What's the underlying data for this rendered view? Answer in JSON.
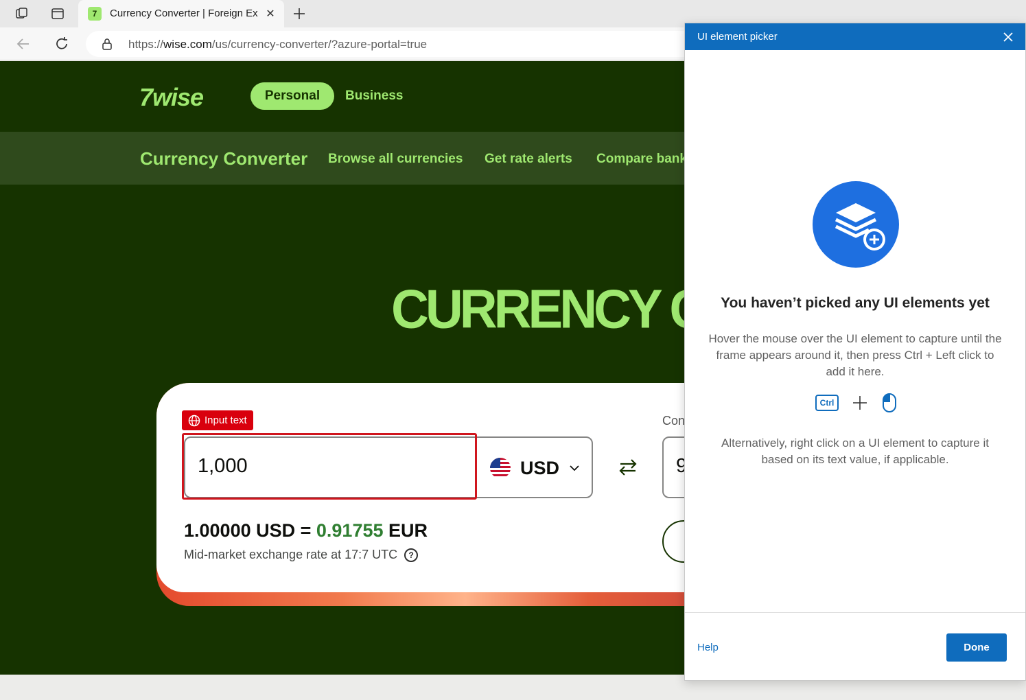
{
  "browser": {
    "tab_title": "Currency Converter | Foreign Exc",
    "url_prefix": "https://",
    "url_host": "wise.com",
    "url_path": "/us/currency-converter/?azure-portal=true"
  },
  "site": {
    "logo": "7wise",
    "nav_personal": "Personal",
    "nav_business": "Business",
    "subnav_title": "Currency Converter",
    "subnav_links": [
      "Browse all currencies",
      "Get rate alerts",
      "Compare bank"
    ],
    "hero": "CURRENCY CO"
  },
  "converter": {
    "tag_label": "Input text",
    "amount": "1,000",
    "from_currency": "USD",
    "convert_label": "Con",
    "converted_partial": "9",
    "rate_left": "1.00000 USD = ",
    "rate_value": "0.91755",
    "rate_right": " EUR",
    "rate_note": "Mid-market exchange rate at 17:7 UTC"
  },
  "picker": {
    "title": "UI element picker",
    "empty_title": "You haven’t picked any UI elements yet",
    "empty_desc": "Hover the mouse over the UI element to capture until the frame appears around it, then press Ctrl + Left click to add it here.",
    "ctrl_key": "Ctrl",
    "alt_desc": "Alternatively, right click on a UI element to capture it based on its text value, if applicable.",
    "help": "Help",
    "done": "Done"
  },
  "colors": {
    "wise_dark": "#163300",
    "wise_green": "#9fe870",
    "picker_blue": "#0f6cbd",
    "highlight_red": "#d0161e"
  }
}
